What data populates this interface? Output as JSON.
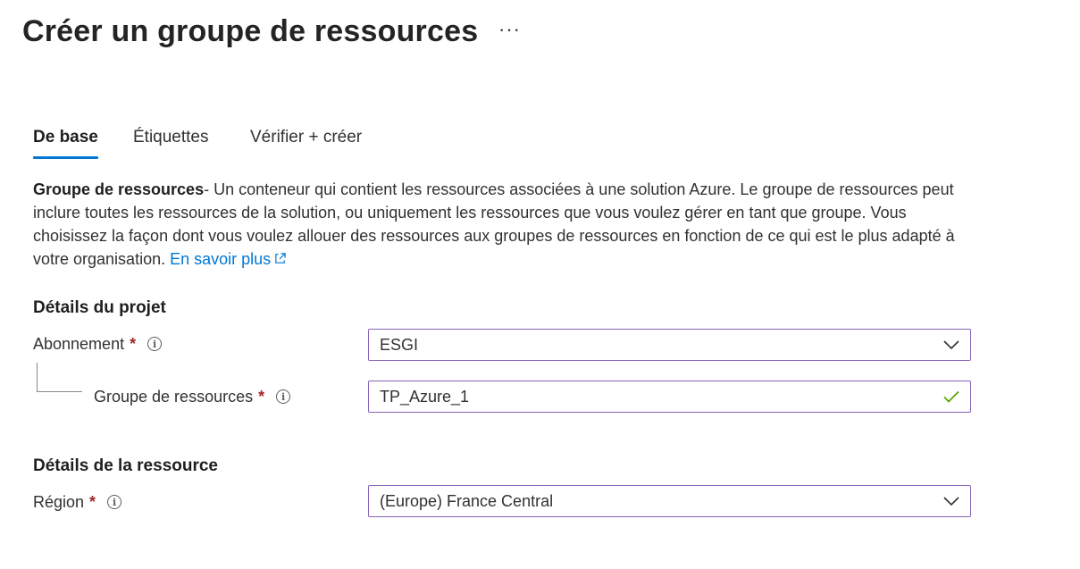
{
  "header": {
    "title": "Créer un groupe de ressources",
    "more_label": "···"
  },
  "tabs": [
    {
      "label": "De base",
      "active": true
    },
    {
      "label": "Étiquettes",
      "active": false
    },
    {
      "label": "Vérifier + créer",
      "active": false
    }
  ],
  "description": {
    "term": "Groupe de ressources",
    "text": "- Un conteneur qui contient les ressources associées à une solution Azure. Le groupe de ressources peut inclure toutes les ressources de la solution, ou uniquement les ressources que vous voulez gérer en tant que groupe. Vous choisissez la façon dont vous voulez allouer des ressources aux groupes de ressources en fonction de ce qui est le plus adapté à votre organisation. ",
    "link_label": "En savoir plus"
  },
  "project_details": {
    "heading": "Détails du projet",
    "subscription": {
      "label": "Abonnement",
      "required_mark": "*",
      "value": "ESGI"
    },
    "resource_group": {
      "label": "Groupe de ressources",
      "required_mark": "*",
      "value": "TP_Azure_1",
      "valid": true
    }
  },
  "resource_details": {
    "heading": "Détails de la ressource",
    "region": {
      "label": "Région",
      "required_mark": "*",
      "value": "(Europe) France Central"
    }
  },
  "icons": {
    "info": "info-icon",
    "chevron": "chevron-down-icon",
    "valid": "checkmark-icon",
    "external": "external-link-icon"
  },
  "colors": {
    "accent": "#0078d4",
    "field_border": "#8764b8",
    "required": "#a4262c",
    "valid": "#57a300"
  }
}
